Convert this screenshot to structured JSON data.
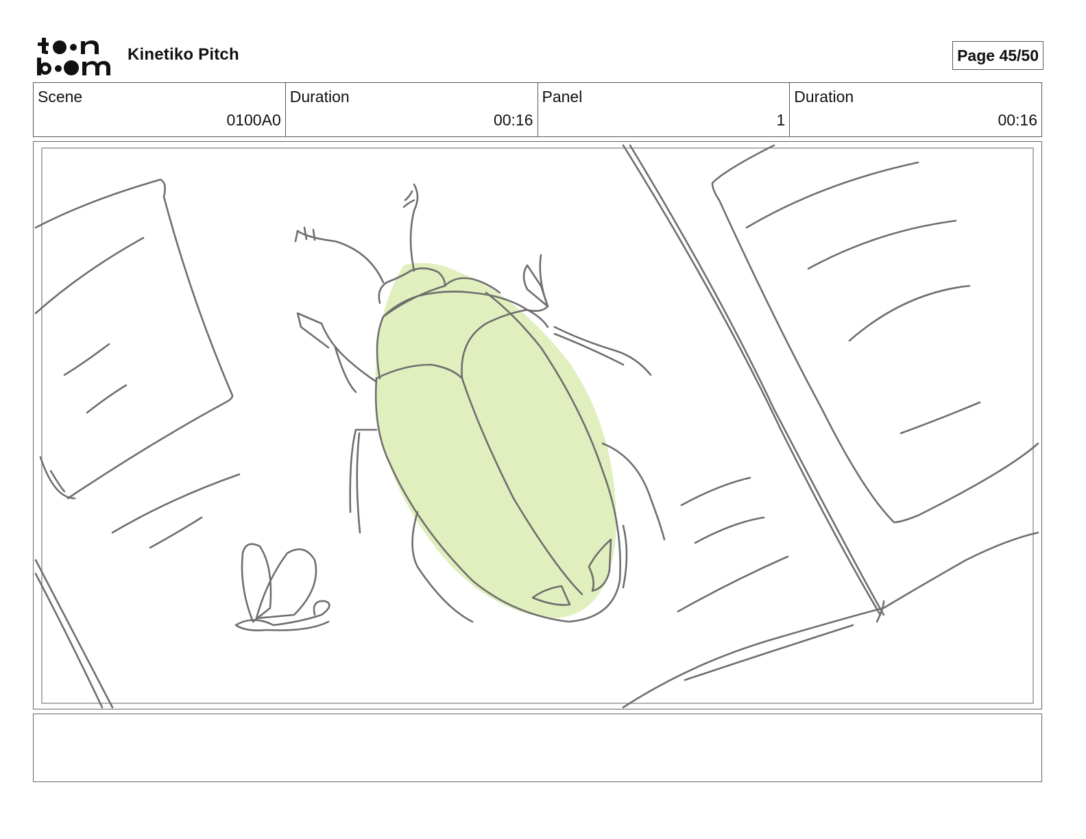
{
  "header": {
    "logo_text": "toonboom",
    "title": "Kinetiko Pitch",
    "page": "Page 45/50"
  },
  "info": {
    "scene_label": "Scene",
    "scene_value": "0100A0",
    "scene_duration_label": "Duration",
    "scene_duration_value": "00:16",
    "panel_label": "Panel",
    "panel_value": "1",
    "panel_duration_label": "Duration",
    "panel_duration_value": "00:16"
  },
  "panel_art": {
    "accent_color": "#e0efbd",
    "line_color": "#6e6e6e"
  },
  "notes": {
    "text": ""
  }
}
